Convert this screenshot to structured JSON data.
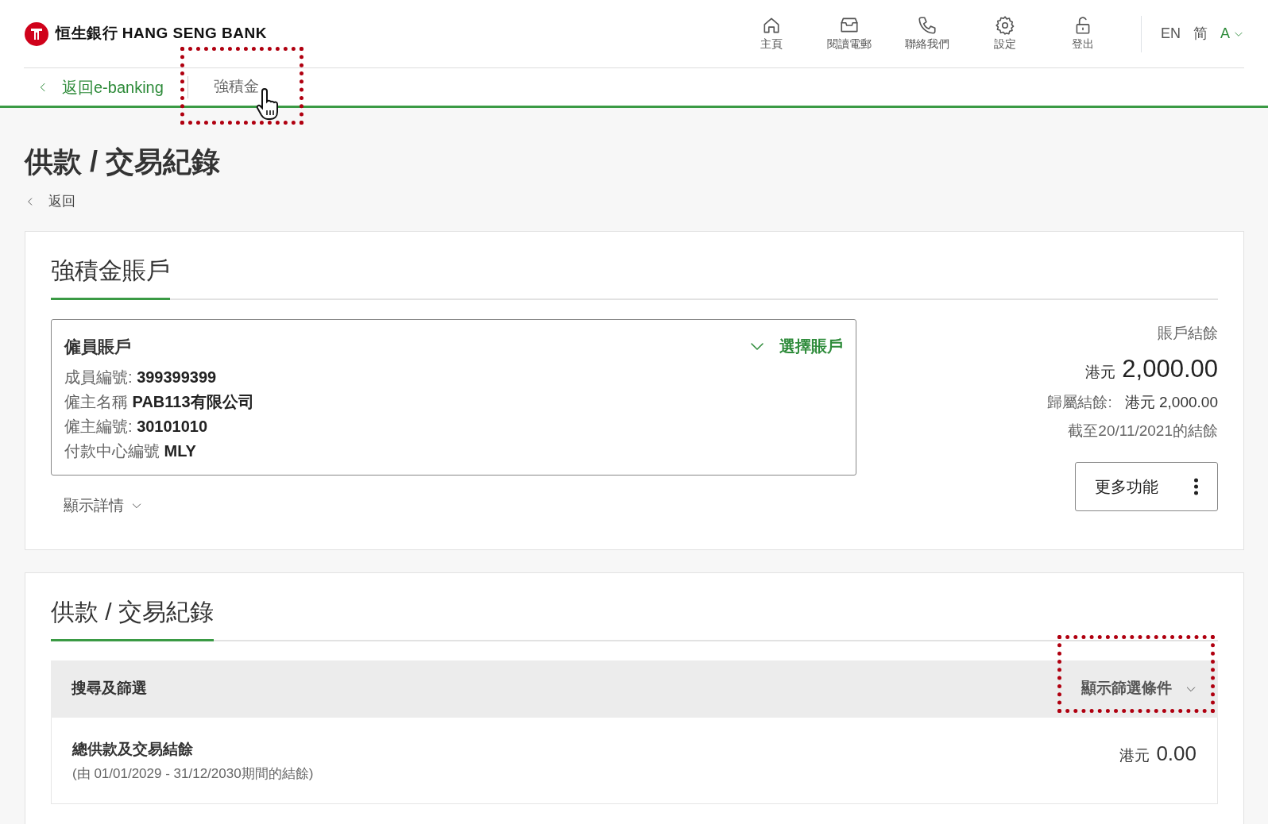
{
  "header": {
    "logo_text": "恒生銀行 HANG SENG BANK",
    "nav": [
      {
        "label": "主頁"
      },
      {
        "label": "閱讀電郵"
      },
      {
        "label": "聯絡我們"
      },
      {
        "label": "設定"
      },
      {
        "label": "登出"
      }
    ],
    "languages": [
      {
        "label": "EN"
      },
      {
        "label": "简"
      }
    ],
    "font_size_menu": {
      "label": "A"
    }
  },
  "subnav": {
    "back_link": "返回e-banking",
    "tabs": [
      {
        "label": "強積金",
        "highlighted": true,
        "cursor": true
      }
    ]
  },
  "page_title": "供款 / 交易紀錄",
  "back_link": "返回",
  "account_section": {
    "tab": "強積金賬戶",
    "account": {
      "type": "僱員賬戶",
      "select_link": "選擇賬戶",
      "fields": [
        {
          "label": "成員編號:",
          "value": "399399399"
        },
        {
          "label": "僱主名稱",
          "value": "PAB113有限公司"
        },
        {
          "label": "僱主編號:",
          "value": "30101010"
        },
        {
          "label": "付款中心編號",
          "value": "MLY"
        }
      ]
    },
    "details_toggle": "顯示詳情",
    "balance": {
      "label": "賬戶結餘",
      "currency": "港元",
      "amount": "2,000.00",
      "vested_label": "歸屬結餘:",
      "vested_value": "港元 2,000.00",
      "as_of": "截至20/11/2021的結餘"
    },
    "more_button": "更多功能"
  },
  "records_section": {
    "tab": "供款 / 交易紀錄",
    "filter_bar": {
      "title": "搜尋及篩選",
      "toggle": "顯示篩選條件",
      "highlighted": true
    },
    "total": {
      "label": "總供款及交易結餘",
      "period": "(由 01/01/2029 - 31/12/2030期間的結餘)",
      "currency": "港元",
      "amount": "0.00"
    }
  }
}
